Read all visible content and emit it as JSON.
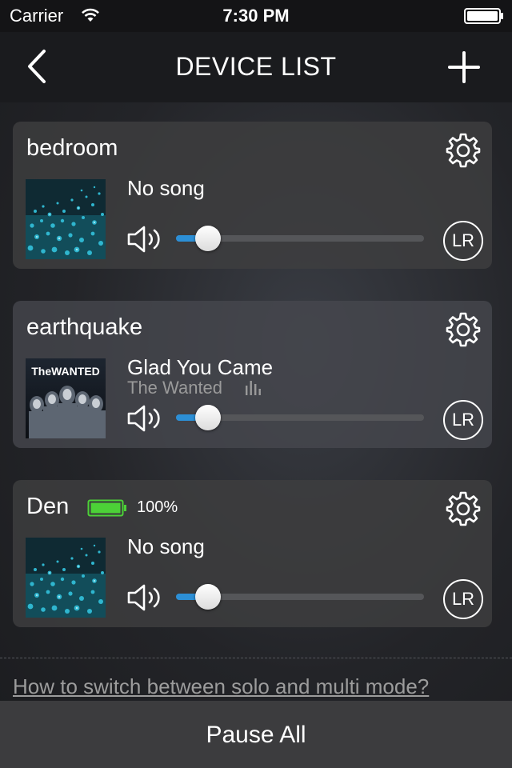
{
  "status_bar": {
    "carrier": "Carrier",
    "time": "7:30 PM"
  },
  "nav": {
    "title": "DEVICE LIST",
    "back_icon": "chevron-left-icon",
    "add_icon": "plus-icon"
  },
  "devices": [
    {
      "name": "bedroom",
      "song": "No song",
      "artist": "",
      "album_art": "blue-water-art",
      "volume": 0.13,
      "channel": "LR"
    },
    {
      "name": "earthquake",
      "song": "Glad You Came",
      "artist": "The Wanted",
      "album_art": "the-wanted-album",
      "album_text": "TheWANTED",
      "volume": 0.13,
      "channel": "LR",
      "playing": true
    },
    {
      "name": "Den",
      "song": "No song",
      "artist": "",
      "album_art": "blue-water-art",
      "volume": 0.13,
      "channel": "LR",
      "battery": "100%"
    }
  ],
  "help_link": "How to switch between solo and multi mode?",
  "footer": {
    "pause_all": "Pause All"
  },
  "colors": {
    "accent": "#2c8fd6",
    "battery": "#4cd137"
  }
}
